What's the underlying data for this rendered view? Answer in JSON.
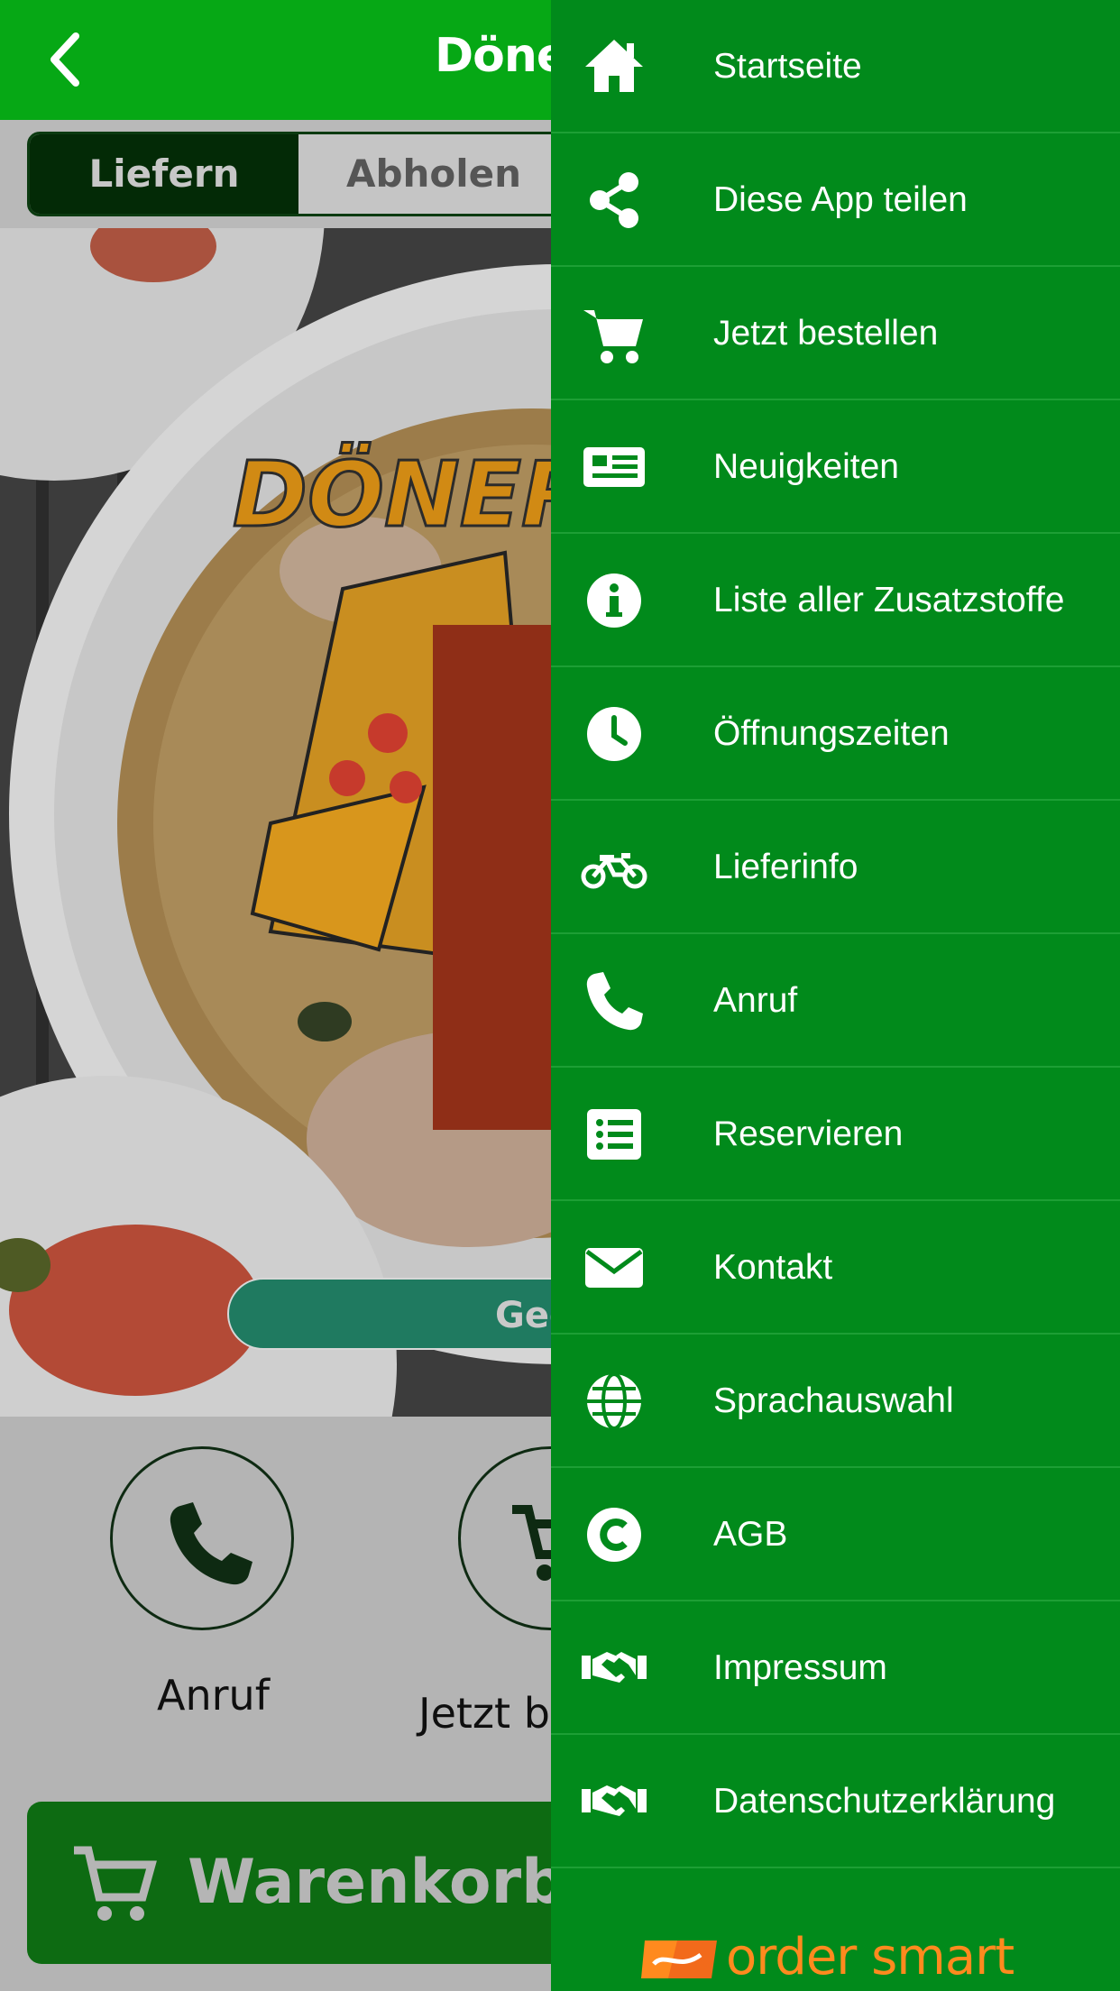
{
  "header": {
    "title": "Döner"
  },
  "mode_toggle": {
    "options": [
      "Liefern",
      "Abholen"
    ],
    "selected": "Liefern"
  },
  "hero": {
    "logo_text": "DÖNER",
    "status_text": "Geö"
  },
  "actions": [
    {
      "label": "Anruf",
      "icon": "phone-icon"
    },
    {
      "label": "Jetzt b",
      "icon": "cart-icon"
    }
  ],
  "cart": {
    "label": "Warenkorb"
  },
  "drawer": {
    "items": [
      {
        "label": "Startseite",
        "icon": "home-icon"
      },
      {
        "label": "Diese App teilen",
        "icon": "share-icon"
      },
      {
        "label": "Jetzt bestellen",
        "icon": "cart-icon"
      },
      {
        "label": "Neuigkeiten",
        "icon": "newspaper-icon"
      },
      {
        "label": "Liste aller Zusatzstoffe",
        "icon": "info-icon"
      },
      {
        "label": "Öffnungszeiten",
        "icon": "clock-icon"
      },
      {
        "label": "Lieferinfo",
        "icon": "motorcycle-icon"
      },
      {
        "label": "Anruf",
        "icon": "phone-icon"
      },
      {
        "label": "Reservieren",
        "icon": "list-icon"
      },
      {
        "label": "Kontakt",
        "icon": "envelope-icon"
      },
      {
        "label": "Sprachauswahl",
        "icon": "globe-icon"
      },
      {
        "label": "AGB",
        "icon": "copyright-icon"
      },
      {
        "label": "Impressum",
        "icon": "handshake-icon"
      },
      {
        "label": "Datenschutzerklärung",
        "icon": "handshake-icon"
      }
    ],
    "footer_logo": "order smart"
  },
  "colors": {
    "header_green": "#06a815",
    "drawer_green": "#018a1b",
    "logo_orange": "#ff8a1e"
  }
}
